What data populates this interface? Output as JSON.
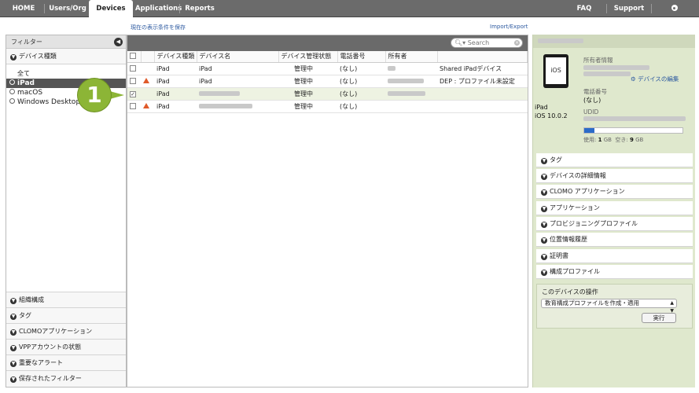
{
  "nav": {
    "tabs": [
      "HOME",
      "Users/Org",
      "Devices",
      "Applications",
      "Reports"
    ],
    "right": [
      "FAQ",
      "Support",
      "Settings"
    ],
    "active": "Devices"
  },
  "links": {
    "save_filter": "現在の表示条件を保存",
    "import_export": "Import/Export"
  },
  "sidebar": {
    "header": "フィルター",
    "device_type_label": "デバイス種類",
    "all_label": "全て",
    "tree": [
      "iPad",
      "macOS",
      "Windows Desktop"
    ],
    "selected": "iPad",
    "bottom": [
      "組織構成",
      "タグ",
      "CLOMOアプリケーション",
      "VPPアカウントの状態",
      "重要なアラート",
      "保存されたフィルター"
    ]
  },
  "search": {
    "placeholder": "Search"
  },
  "table": {
    "headers": [
      "デバイス種類",
      "デバイス名",
      "デバイス管理状態",
      "電話番号",
      "所有者"
    ],
    "rows": [
      {
        "type": "iPad",
        "name": "iPad",
        "status": "管理中",
        "phone": "(なし)",
        "note": "Shared iPadデバイス",
        "warn": false,
        "checked": false
      },
      {
        "type": "iPad",
        "name": "iPad",
        "status": "管理中",
        "phone": "(なし)",
        "note": "DEP : プロファイル未設定",
        "warn": true,
        "checked": false
      },
      {
        "type": "iPad",
        "name": "",
        "status": "管理中",
        "phone": "(なし)",
        "note": "",
        "warn": false,
        "checked": true
      },
      {
        "type": "iPad",
        "name": "",
        "status": "管理中",
        "phone": "(なし)",
        "note": "",
        "warn": true,
        "checked": false
      }
    ]
  },
  "callout": {
    "number": "1"
  },
  "detail": {
    "screen_label": "iOS",
    "device_name": "iPad",
    "os_version": "iOS 10.0.2",
    "owner_label": "所有者情報",
    "edit_link": "デバイスの編集",
    "phone_label": "電話番号",
    "phone_value": "(なし)",
    "udid_label": "UDID",
    "storage": {
      "used_prefix": "使用:",
      "used": "1",
      "used_unit": "GB",
      "free_prefix": "空き:",
      "free": "9",
      "free_unit": "GB",
      "fraction": 0.1
    },
    "sections": [
      "タグ",
      "デバイスの詳細情報",
      "CLOMO アプリケーション",
      "アプリケーション",
      "プロビジョニングプロファイル",
      "位置情報履歴",
      "証明書",
      "構成プロファイル"
    ],
    "operation": {
      "title": "このデバイスの操作",
      "selected_option": "教育構成プロファイルを作成・適用",
      "run_label": "実行"
    }
  }
}
